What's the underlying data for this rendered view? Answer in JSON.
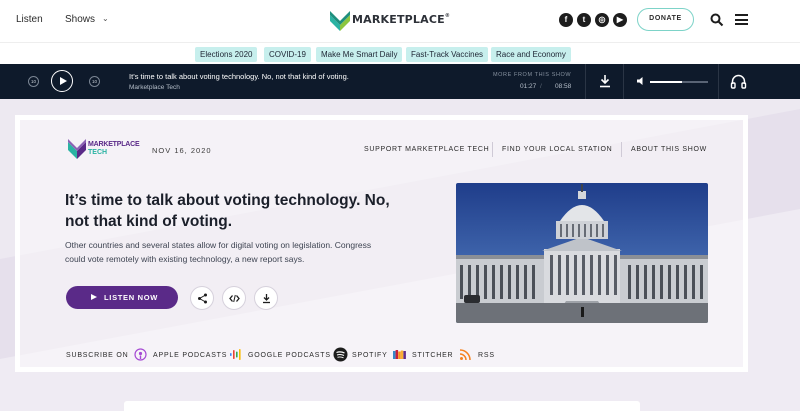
{
  "topnav": {
    "listen": "Listen",
    "shows": "Shows",
    "logo_text": "MARKETPLACE",
    "logo_registered": "®",
    "donate": "DONATE",
    "social": [
      {
        "name": "facebook-icon",
        "glyph": "f"
      },
      {
        "name": "twitter-icon",
        "glyph": "t"
      },
      {
        "name": "instagram-icon",
        "glyph": "◎"
      },
      {
        "name": "youtube-icon",
        "glyph": "▶"
      }
    ]
  },
  "topics": [
    "Elections 2020",
    "COVID-19",
    "Make Me Smart Daily",
    "Fast-Track Vaccines",
    "Race and Economy"
  ],
  "player": {
    "back_label": "10",
    "fwd_label": "10",
    "episode_title": "It’s time to talk about voting technology. No, not that kind of voting.",
    "show_name": "Marketplace Tech",
    "more_label": "MORE FROM THIS SHOW",
    "elapsed": "01:27",
    "separator": "/",
    "duration": "08:58",
    "volume": 0.55
  },
  "episode": {
    "show_logo_line1": "MARKETPLACE",
    "show_logo_line2": "TECH",
    "date": "NOV 16, 2020",
    "links": [
      "SUPPORT MARKETPLACE TECH",
      "FIND YOUR LOCAL STATION",
      "ABOUT THIS SHOW"
    ],
    "headline": "It’s time to talk about voting technology. No, not that kind of voting.",
    "summary": "Other countries and several states allow for digital voting on legislation. Congress could vote remotely with existing technology, a new report says.",
    "listen_label": "LISTEN NOW"
  },
  "subscribe": {
    "label": "SUBSCRIBE ON",
    "items": [
      {
        "label": "APPLE PODCASTS",
        "icon": "apple-podcasts-icon"
      },
      {
        "label": "GOOGLE PODCASTS",
        "icon": "google-podcasts-icon"
      },
      {
        "label": "SPOTIFY",
        "icon": "spotify-icon"
      },
      {
        "label": "STITCHER",
        "icon": "stitcher-icon"
      },
      {
        "label": "RSS",
        "icon": "rss-icon"
      }
    ]
  },
  "colors": {
    "accent_purple": "#5a2a88",
    "accent_teal": "#2ab3a3",
    "pill_bg": "#c7efed",
    "player_bg": "#0e1a2b"
  }
}
